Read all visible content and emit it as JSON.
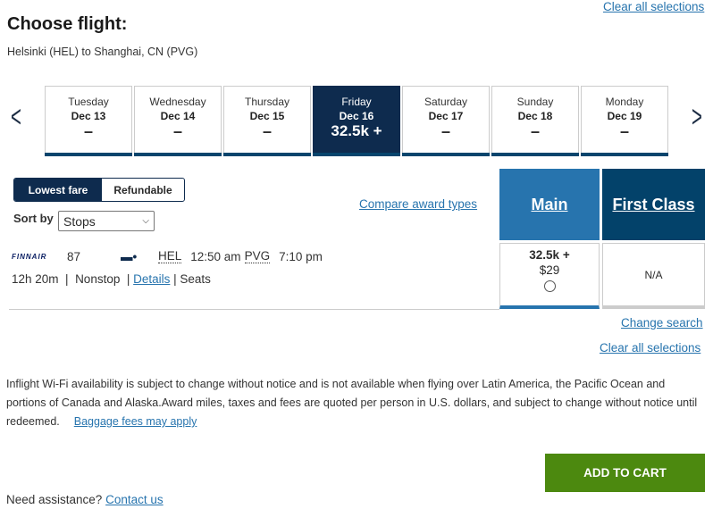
{
  "top_link": "Clear all selections",
  "title": "Choose flight:",
  "route": "Helsinki (HEL) to Shanghai, CN (PVG)",
  "dates": [
    {
      "day": "Tuesday",
      "date": "Dec 13",
      "price": "–"
    },
    {
      "day": "Wednesday",
      "date": "Dec 14",
      "price": "–"
    },
    {
      "day": "Thursday",
      "date": "Dec 15",
      "price": "–"
    },
    {
      "day": "Friday",
      "date": "Dec 16",
      "price": "32.5k +",
      "selected": true
    },
    {
      "day": "Saturday",
      "date": "Dec 17",
      "price": "–"
    },
    {
      "day": "Sunday",
      "date": "Dec 18",
      "price": "–"
    },
    {
      "day": "Monday",
      "date": "Dec 19",
      "price": "–"
    }
  ],
  "fare_toggle": {
    "lowest": "Lowest fare",
    "refundable": "Refundable",
    "active": "Lowest fare"
  },
  "sort": {
    "label": "Sort by",
    "value": "Stops"
  },
  "compare_link": "Compare award types",
  "cabins": {
    "main": "Main",
    "first": "First Class",
    "main_color": "#2774ae",
    "first_color": "#03426a"
  },
  "flight": {
    "airline": "FINNAIR",
    "number": "87",
    "from": "HEL",
    "depart": "12:50 am",
    "to": "PVG",
    "arrive": "7:10 pm",
    "duration": "12h 20m",
    "stops": "Nonstop",
    "details": "Details",
    "seats": "Seats",
    "main_fare": "32.5k +",
    "main_fee": "$29",
    "first_fare": "N/A"
  },
  "change_search": "Change search",
  "clear_all": "Clear all selections",
  "disclaimer": "Inflight Wi-Fi availability is subject to change without notice and is not available when flying over Latin America, the Pacific Ocean and portions of Canada and Alaska.Award miles, taxes and fees are quoted per person in U.S. dollars, and subject to change without notice until redeemed.",
  "baggage": "Baggage fees may apply",
  "add_to_cart": "ADD TO CART",
  "help": {
    "text": "Need assistance?",
    "link": "Contact us"
  }
}
